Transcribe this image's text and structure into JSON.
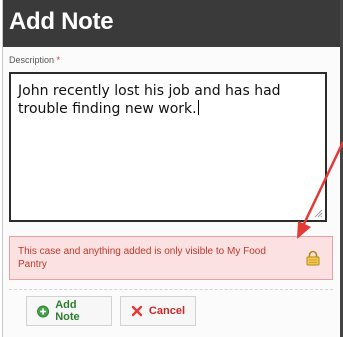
{
  "dialog": {
    "title": "Add Note"
  },
  "form": {
    "description_label": "Description",
    "required_marker": "*",
    "description_value": "John recently lost his job and has had trouble finding new work."
  },
  "notice": {
    "text": "This case and anything added is only visible to My Food Pantry",
    "icon": "lock-icon"
  },
  "actions": {
    "add_label": "Add Note",
    "add_icon": "add-circle-icon",
    "cancel_label": "Cancel",
    "cancel_icon": "x-icon"
  },
  "colors": {
    "titlebar": "#3a3a3a",
    "notice_bg": "#fbe1e1",
    "notice_text": "#c0392b",
    "annotation_arrow": "#e53935"
  }
}
